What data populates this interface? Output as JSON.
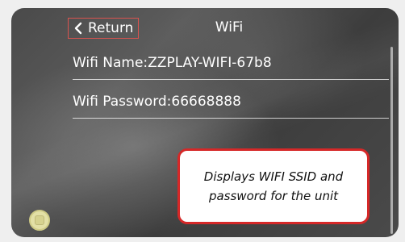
{
  "header": {
    "return_label": "Return",
    "title": "WiFi"
  },
  "wifi": {
    "name_row": "Wifi Name:ZZPLAY-WIFI-67b8",
    "password_row": "Wifi Password:66668888"
  },
  "callout": {
    "line1": "Displays WIFI SSID and",
    "line2": "password for the unit"
  },
  "colors": {
    "highlight": "#d62828",
    "home_button": "#e3e0a6"
  },
  "icons": {
    "return": "chevron-left-icon",
    "home": "home-button-icon"
  }
}
